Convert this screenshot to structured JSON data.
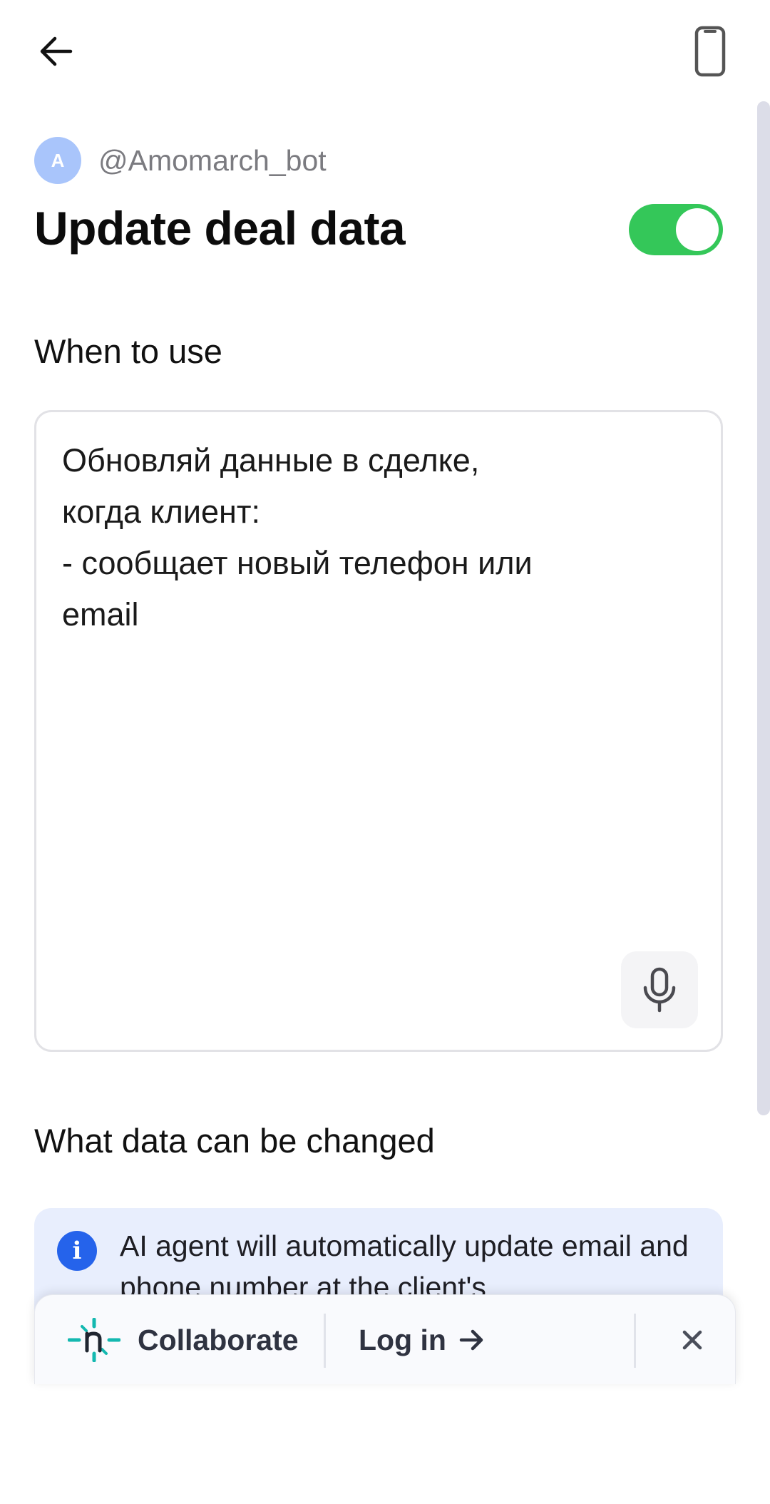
{
  "header": {
    "back_icon": "arrow-left-icon",
    "device_icon": "phone-icon"
  },
  "bot": {
    "avatar_letter": "A",
    "avatar_color": "#a9c5fb",
    "handle": "@Amomarch_bot"
  },
  "page": {
    "title": "Update deal data",
    "enabled": true,
    "toggle_color": "#34c759"
  },
  "when_to_use": {
    "label": "When to use",
    "text": "Обновляй данные в сделке,\nкогда клиент:\n- сообщает новый телефон или\nemail",
    "mic_icon": "microphone-icon"
  },
  "what_data": {
    "label": "What data can be changed",
    "info_icon": "info-icon",
    "info_text": "AI agent will automatically update email and phone number at the client's"
  },
  "collab_bar": {
    "logo_icon": "n-logo-icon",
    "collaborate_label": "Collaborate",
    "login_label": "Log in",
    "login_arrow_icon": "arrow-right-icon",
    "close_icon": "close-icon",
    "accent_color": "#14b8b0"
  }
}
